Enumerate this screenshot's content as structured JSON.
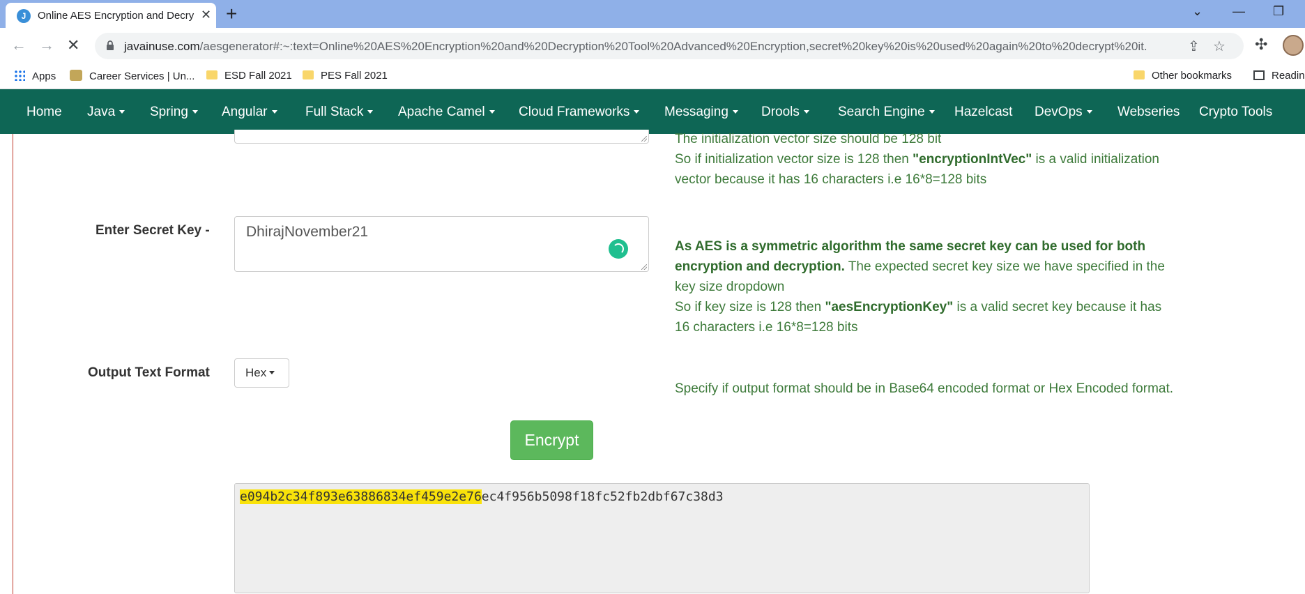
{
  "browser": {
    "tab_title": "Online AES Encryption and Decry",
    "favicon_letter": "J",
    "url_host": "javainuse.com",
    "url_rest": "/aesgenerator#:~:text=Online%20AES%20Encryption%20and%20Decryption%20Tool%20Advanced%20Encryption,secret%20key%20is%20used%20again%20to%20decrypt%20it.",
    "bookmarks": {
      "apps": "Apps",
      "career": "Career Services | Un...",
      "esd": "ESD Fall 2021",
      "pes": "PES Fall 2021",
      "other": "Other bookmarks",
      "reading": "Readin"
    }
  },
  "nav": {
    "items": [
      "Home",
      "Java",
      "Spring",
      "Angular",
      "Full Stack",
      "Apache Camel",
      "Cloud Frameworks",
      "Messaging",
      "Drools",
      "Search Engine",
      "Hazelcast",
      "DevOps",
      "Webseries",
      "Crypto Tools"
    ]
  },
  "iv_help": {
    "line1": "The initialization vector size should be 128 bit",
    "line2_pre": "So if initialization vector size is 128 then ",
    "line2_bold": "\"encryptionIntVec\"",
    "line2_post": " is a valid initialization",
    "line3": "vector because it has 16 characters i.e 16*8=128 bits"
  },
  "secret_key": {
    "label": "Enter Secret Key -",
    "value": "DhirajNovember21"
  },
  "key_help": {
    "bold1": "As AES is a symmetric algorithm the same secret key can be used for both",
    "bold2": "encryption and decryption.",
    "text2": " The expected secret key size we have specified in the",
    "line3": "key size dropdown",
    "line4_pre": "So if key size is 128 then ",
    "line4_bold": "\"aesEncryptionKey\"",
    "line4_post": " is a valid secret key because it has",
    "line5": "16 characters i.e 16*8=128 bits"
  },
  "output_format": {
    "label": "Output Text Format",
    "selected": "Hex",
    "help": "Specify if output format should be in Base64 encoded format or Hex Encoded format."
  },
  "encrypt_button": "Encrypt",
  "output": {
    "highlighted": "e094b2c34f893e63886834ef459e2e76",
    "rest": "ec4f956b5098f18fc52fb2dbf67c38d3"
  }
}
